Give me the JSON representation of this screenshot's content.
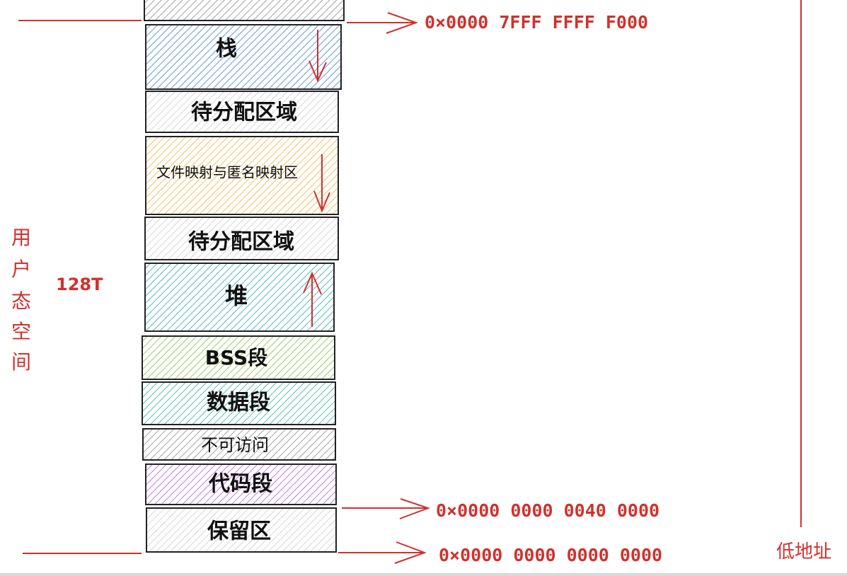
{
  "colors": {
    "red": "#d0312d",
    "ink": "#222222",
    "segments": {
      "top_cap": "#8a8a8a",
      "stack": "#3b7fd4",
      "unallocated": "#bdbdbd",
      "mmap": "#f2b134",
      "heap": "#2aa6b8",
      "bss": "#8cbc3c",
      "data": "#2bb39a",
      "inaccessible": "#8c8c8c",
      "code": "#b45ad6",
      "reserved": "#bdbdbd"
    }
  },
  "segments": {
    "stack": "栈",
    "unallocated_top": "待分配区域",
    "mmap": "文件映射与匿名映射区",
    "unallocated_mid": "待分配区域",
    "heap": "堆",
    "bss": "BSS段",
    "data": "数据段",
    "inaccessible": "不可访问",
    "code": "代码段",
    "reserved": "保留区"
  },
  "addresses": {
    "top": "0×0000 7FFF FFFF F000",
    "code_start": "0×0000 0000 0040 0000",
    "zero": "0×0000 0000 0000 0000"
  },
  "left_label": {
    "chars": [
      "用",
      "户",
      "态",
      "空",
      "间"
    ],
    "size": "128T"
  },
  "right_label": "低地址",
  "icons": {
    "stack_arrow": "arrow-down-icon",
    "mmap_arrow": "arrow-down-icon",
    "heap_arrow": "arrow-up-icon",
    "address_pointer": "arrow-right-icon"
  }
}
